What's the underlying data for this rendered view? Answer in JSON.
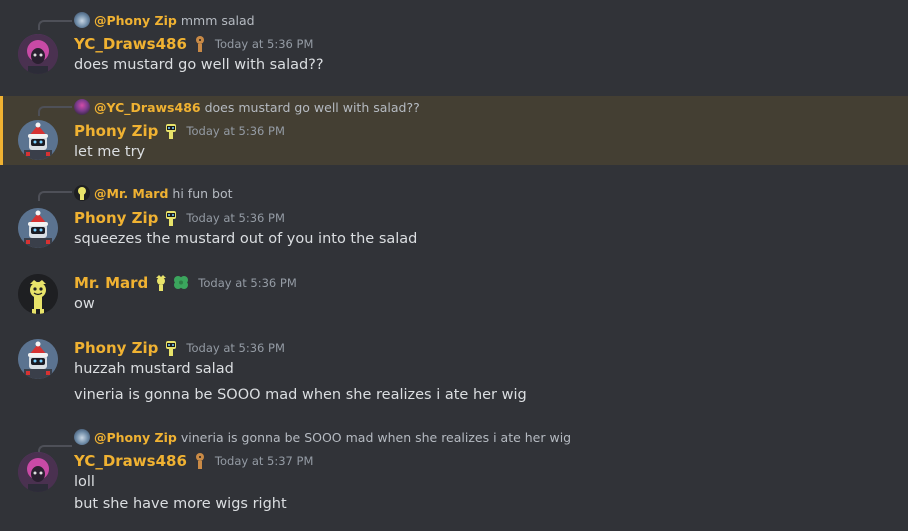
{
  "users": {
    "yc": {
      "name": "YC_Draws486",
      "color": "#f0b232"
    },
    "pz": {
      "name": "Phony Zip",
      "color": "#f0b232"
    },
    "mm": {
      "name": "Mr. Mard",
      "color": "#f0b232"
    }
  },
  "messages": [
    {
      "reply": {
        "mention": "@Phony Zip",
        "text": "mmm salad"
      },
      "author": "YC_Draws486",
      "timestamp": "Today at 5:36 PM",
      "lines": [
        "does mustard go well with salad??"
      ]
    },
    {
      "highlighted": true,
      "reply": {
        "mention": "@YC_Draws486",
        "text": "does mustard go well with salad??"
      },
      "author": "Phony Zip",
      "timestamp": "Today at 5:36 PM",
      "lines": [
        "let me try"
      ]
    },
    {
      "reply": {
        "mention": "@Mr. Mard",
        "text": "hi fun bot"
      },
      "author": "Phony Zip",
      "timestamp": "Today at 5:36 PM",
      "lines": [
        "squeezes the mustard out of you into the salad"
      ]
    },
    {
      "author": "Mr. Mard",
      "timestamp": "Today at 5:36 PM",
      "lines": [
        "ow"
      ]
    },
    {
      "author": "Phony Zip",
      "timestamp": "Today at 5:36 PM",
      "lines": [
        "huzzah mustard salad",
        "vineria is gonna be SOOO mad when she realizes i ate her wig"
      ]
    },
    {
      "reply": {
        "mention": "@Phony Zip",
        "text": "vineria is gonna be SOOO mad when she realizes i ate her wig"
      },
      "author": "YC_Draws486",
      "timestamp": "Today at 5:37 PM",
      "lines": [
        "loll",
        "but she have more wigs right"
      ]
    }
  ],
  "colors": {
    "background": "#313338",
    "highlight_bg": "#443f33",
    "highlight_bar": "#f0b232",
    "timestamp": "#949ba4",
    "text": "#dbdee1"
  }
}
